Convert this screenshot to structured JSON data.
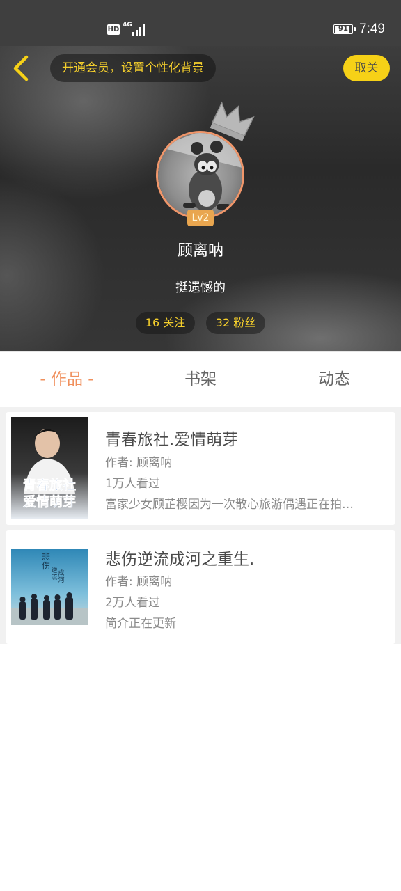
{
  "status_bar": {
    "hd": "HD",
    "network": "4G",
    "battery": "91",
    "battery_level": 0.91,
    "time": "7:49"
  },
  "header": {
    "back_icon": "chevron-left-icon",
    "member_banner": "开通会员，设置个性化背景",
    "unfollow_label": "取关",
    "level": "Lv2",
    "username": "顾离呐",
    "signature": "挺遗憾的",
    "following": "16 关注",
    "fans": "32 粉丝",
    "accent_color": "#f6d117",
    "ring_color": "#f0966a"
  },
  "tabs": [
    {
      "label": "- 作品 -",
      "active": true
    },
    {
      "label": "书架",
      "active": false
    },
    {
      "label": "动态",
      "active": false
    }
  ],
  "books": [
    {
      "title": "青春旅社.爱情萌芽",
      "author": "作者: 顾离呐",
      "views": "1万人看过",
      "description": "富家少女顾芷樱因为一次散心旅游偶遇正在拍…",
      "cover_text": [
        "青春旅社",
        "爱情萌芽"
      ]
    },
    {
      "title": "悲伤逆流成河之重生.",
      "author": "作者: 顾离呐",
      "views": "2万人看过",
      "description": "简介正在更新",
      "cover_text": [
        "悲",
        "伤",
        "逆",
        "流",
        "成",
        "河"
      ]
    }
  ]
}
